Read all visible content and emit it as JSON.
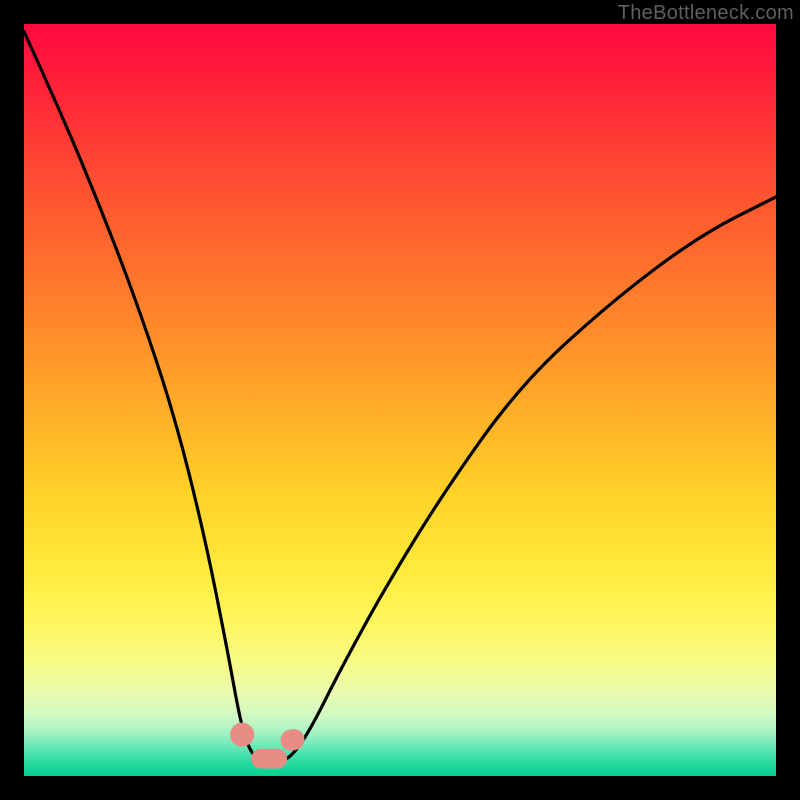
{
  "watermark": "TheBottleneck.com",
  "chart_data": {
    "type": "line",
    "title": "",
    "xlabel": "",
    "ylabel": "",
    "xlim": [
      0,
      100
    ],
    "ylim": [
      0,
      100
    ],
    "grid": false,
    "legend": false,
    "series": [
      {
        "name": "bottleneck-curve",
        "color": "#000000",
        "x": [
          0,
          5,
          10,
          15,
          20,
          24,
          27,
          29,
          30.5,
          32,
          34,
          35.5,
          38,
          42,
          48,
          56,
          66,
          78,
          90,
          100
        ],
        "values": [
          99,
          88,
          76,
          63,
          48,
          32,
          17,
          6,
          2.5,
          2,
          2,
          2.5,
          6,
          14,
          25,
          38,
          52,
          63,
          72,
          77
        ]
      }
    ],
    "annotations": [
      {
        "name": "fit-marker-left",
        "x": 29.0,
        "y": 5.5,
        "color": "#e88d86",
        "shape": "dot",
        "r": 1.6
      },
      {
        "name": "fit-marker-right",
        "x": 35.7,
        "y": 4.8,
        "color": "#e88d86",
        "shape": "capsule",
        "r": 1.4,
        "len": 3.2,
        "angle": 78
      },
      {
        "name": "fit-region",
        "x0": 30.2,
        "x1": 35.0,
        "y": 2.3,
        "color": "#e88d86",
        "shape": "bar",
        "h": 2.6
      }
    ],
    "gradient_bands": [
      {
        "pct": 0,
        "color": "#ff0b3f"
      },
      {
        "pct": 50,
        "color": "#ffb327"
      },
      {
        "pct": 80,
        "color": "#fff65a"
      },
      {
        "pct": 100,
        "color": "#04d08f"
      }
    ]
  }
}
